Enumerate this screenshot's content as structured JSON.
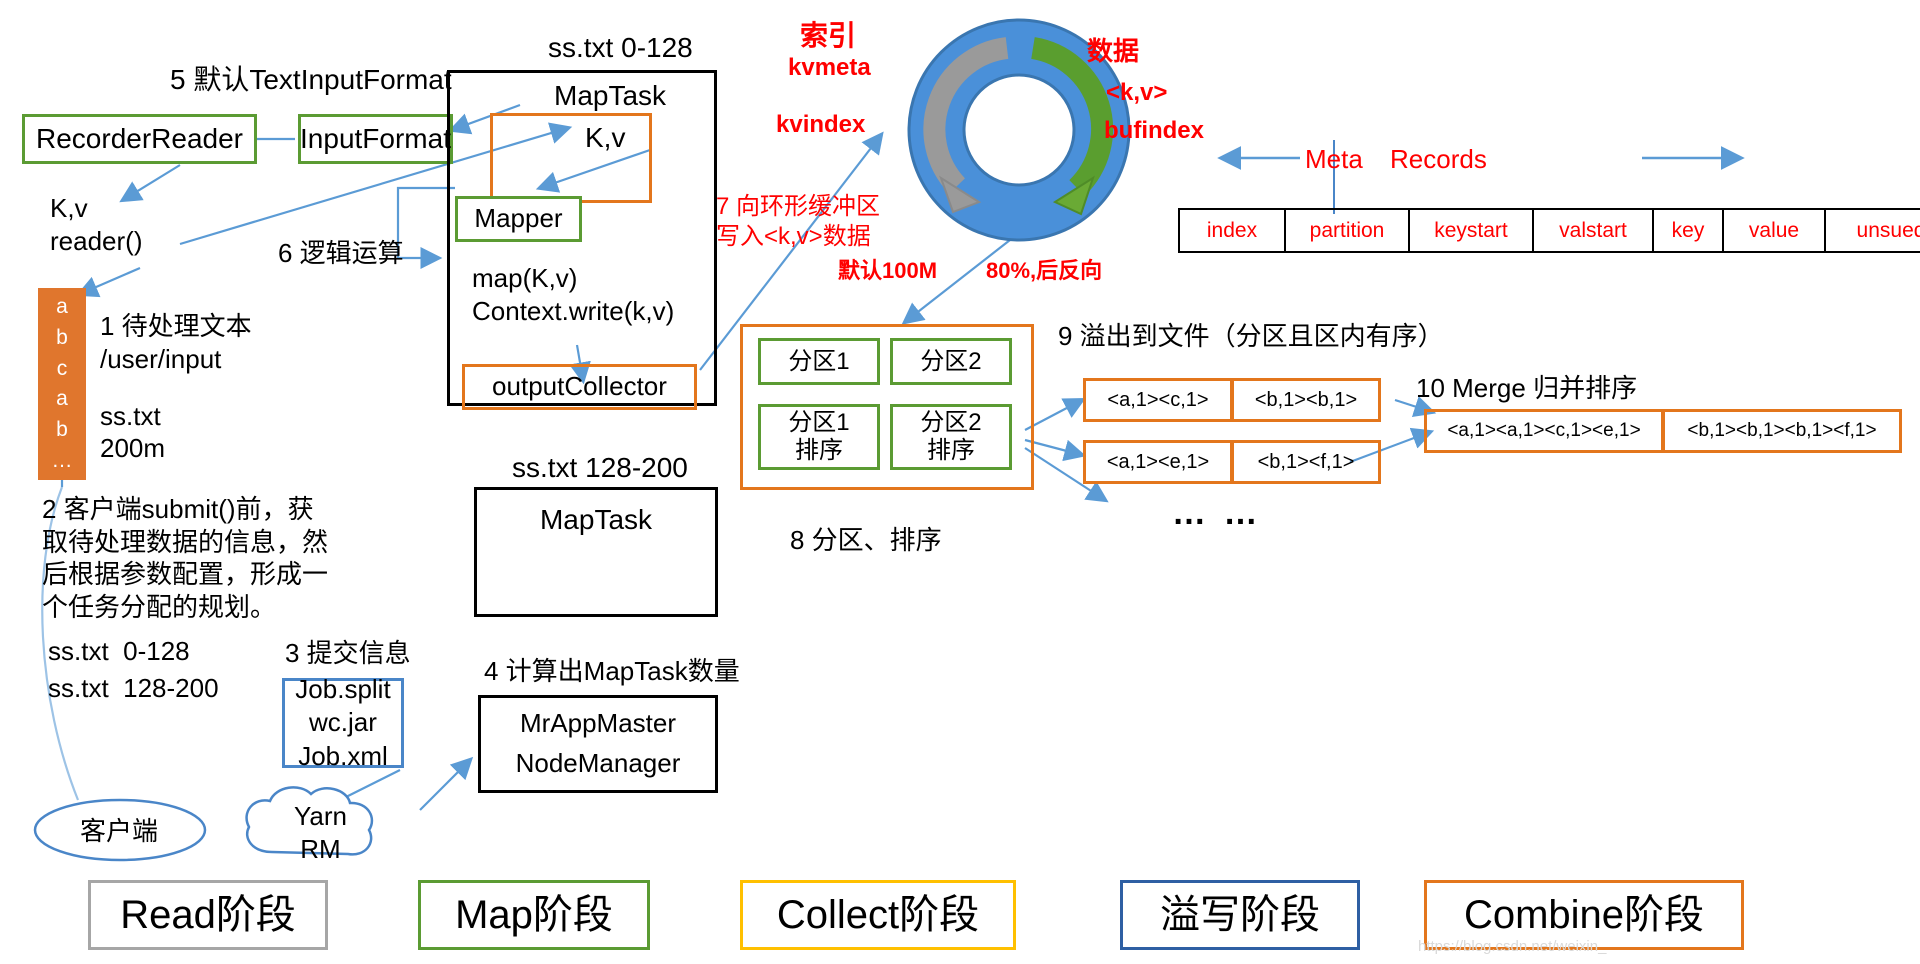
{
  "left_flow": {
    "step5_label": "5 默认TextInputFormat",
    "recorder_reader": "RecorderReader",
    "input_format": "InputFormat",
    "kv_reader": "K,v\nreader()",
    "step6_label": "6 逻辑运算",
    "file_block_letters": [
      "a",
      "b",
      "c",
      "a",
      "b",
      "…"
    ],
    "step1_text": "1 待处理文本\n/user/input",
    "file_name": "ss.txt",
    "file_size": "200m",
    "step2_text": "2 客户端submit()前，获\n取待处理数据的信息，然\n后根据参数配置，形成一\n个任务分配的规划。",
    "split1": "ss.txt  0-128",
    "split2": "ss.txt  128-200",
    "step3_label": "3 提交信息",
    "job_files": "Job.split\nwc.jar\nJob.xml",
    "step4_label": "4 计算出MapTask数量",
    "mrappmaster": "MrAppMaster",
    "nodemanager": "NodeManager",
    "client": "客户端",
    "yarn_rm": "Yarn\nRM"
  },
  "maptask": {
    "title_top": "ss.txt 0-128",
    "name": "MapTask",
    "kv": "K,v",
    "mapper": "Mapper",
    "map_calls": "map(K,v)\nContext.write(k,v)",
    "output_collector": "outputCollector",
    "title_bottom": "ss.txt 128-200",
    "name2": "MapTask"
  },
  "ring_buffer": {
    "index_label": "索引",
    "kvmeta": "kvmeta",
    "kvindex": "kvindex",
    "data_label": "数据",
    "kv_pair": "<k,v>",
    "bufindex": "bufindex",
    "step7_text": "7 向环形缓冲区\n写入<k,v>数据",
    "default_size": "默认100M",
    "spill_threshold": "80%,后反向",
    "colors": {
      "ring": "#4a90d9",
      "meta_arrow": "#9a9a9a",
      "data_arrow": "#5a9e2f",
      "label": "#ff0000"
    }
  },
  "meta_records": {
    "meta_label": "Meta",
    "records_label": "Records",
    "columns": [
      "index",
      "partition",
      "keystart",
      "valstart",
      "key",
      "value",
      "unsued"
    ]
  },
  "partition_sort": {
    "p1": "分区1",
    "p2": "分区2",
    "p1_sorted": "分区1\n排序",
    "p2_sorted": "分区2\n排序",
    "step8_label": "8 分区、排序"
  },
  "spill": {
    "step9_label": "9 溢出到文件（分区且区内有序）",
    "rows": [
      [
        "<a,1><c,1>",
        "<b,1><b,1>"
      ],
      [
        "<a,1><e,1>",
        "<b,1><f,1>"
      ]
    ],
    "ellipsis": "… …"
  },
  "merge": {
    "step10_label": "10 Merge 归并排序",
    "cells": [
      "<a,1><a,1><c,1><e,1>",
      "<b,1><b,1><b,1><f,1>"
    ]
  },
  "phases": [
    {
      "label": "Read阶段",
      "color": "#a6a6a6"
    },
    {
      "label": "Map阶段",
      "color": "#5b9b33"
    },
    {
      "label": "Collect阶段",
      "color": "#ffc000"
    },
    {
      "label": "溢写阶段",
      "color": "#2e5fa3"
    },
    {
      "label": "Combine阶段",
      "color": "#e3761c"
    }
  ],
  "watermark": "https://blog.csdn.net/weixin_"
}
